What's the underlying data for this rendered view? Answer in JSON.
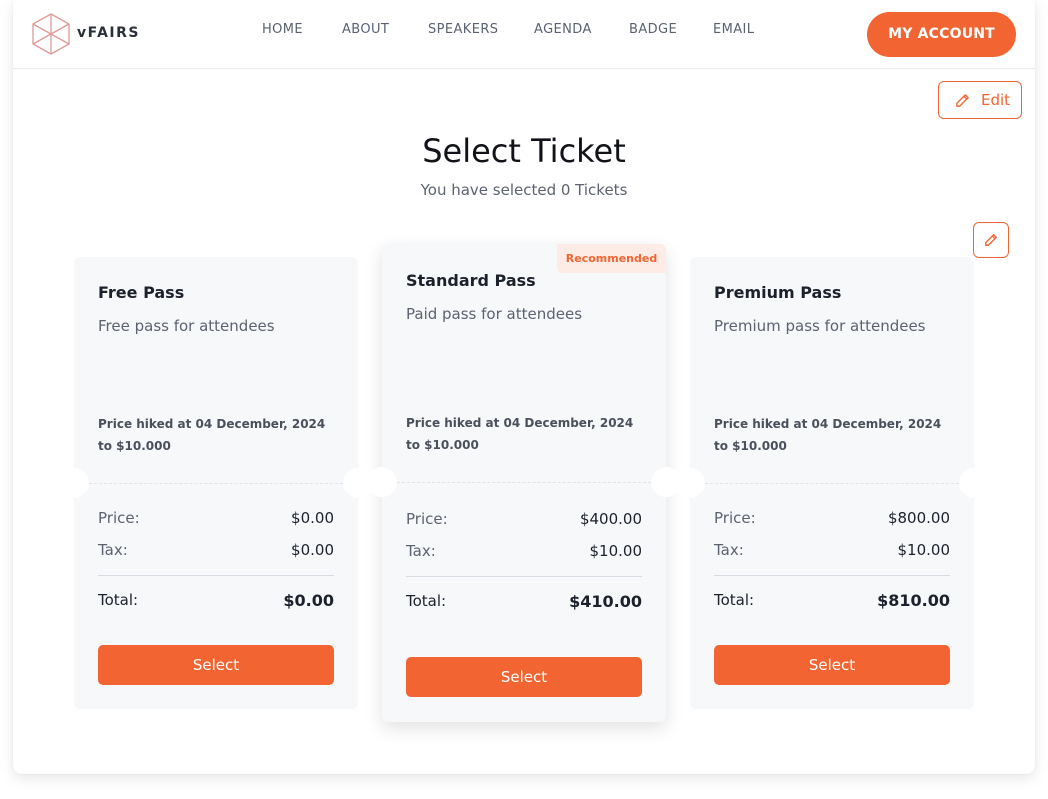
{
  "brand": {
    "name": "vFAIRS",
    "accent": "#f26532",
    "logo_icon": "hexagon-cube-icon"
  },
  "nav": {
    "items": [
      {
        "label": "HOME"
      },
      {
        "label": "ABOUT"
      },
      {
        "label": "SPEAKERS"
      },
      {
        "label": "AGENDA"
      },
      {
        "label": "BADGE"
      },
      {
        "label": "EMAIL"
      }
    ],
    "account_label": "MY ACCOUNT"
  },
  "edit": {
    "label": "Edit",
    "icon": "pencil-icon"
  },
  "page": {
    "title": "Select Ticket",
    "subtitle": "You have selected 0 Tickets"
  },
  "tickets": [
    {
      "name": "Free Pass",
      "description": "Free pass for attendees",
      "note": "Price hiked at 04 December, 2024 to $10.000",
      "price_label": "Price:",
      "price": "$0.00",
      "tax_label": "Tax:",
      "tax": "$0.00",
      "total_label": "Total:",
      "total": "$0.00",
      "select_label": "Select"
    },
    {
      "name": "Standard Pass",
      "description": "Paid pass for attendees",
      "note": "Price hiked at 04 December, 2024 to $10.000",
      "price_label": "Price:",
      "price": "$400.00",
      "tax_label": "Tax:",
      "tax": "$10.00",
      "total_label": "Total:",
      "total": "$410.00",
      "select_label": "Select",
      "badge": "Recommended"
    },
    {
      "name": "Premium Pass",
      "description": "Premium pass for attendees",
      "note": "Price hiked at 04 December, 2024 to $10.000",
      "price_label": "Price:",
      "price": "$800.00",
      "tax_label": "Tax:",
      "tax": "$10.00",
      "total_label": "Total:",
      "total": "$810.00",
      "select_label": "Select"
    }
  ]
}
